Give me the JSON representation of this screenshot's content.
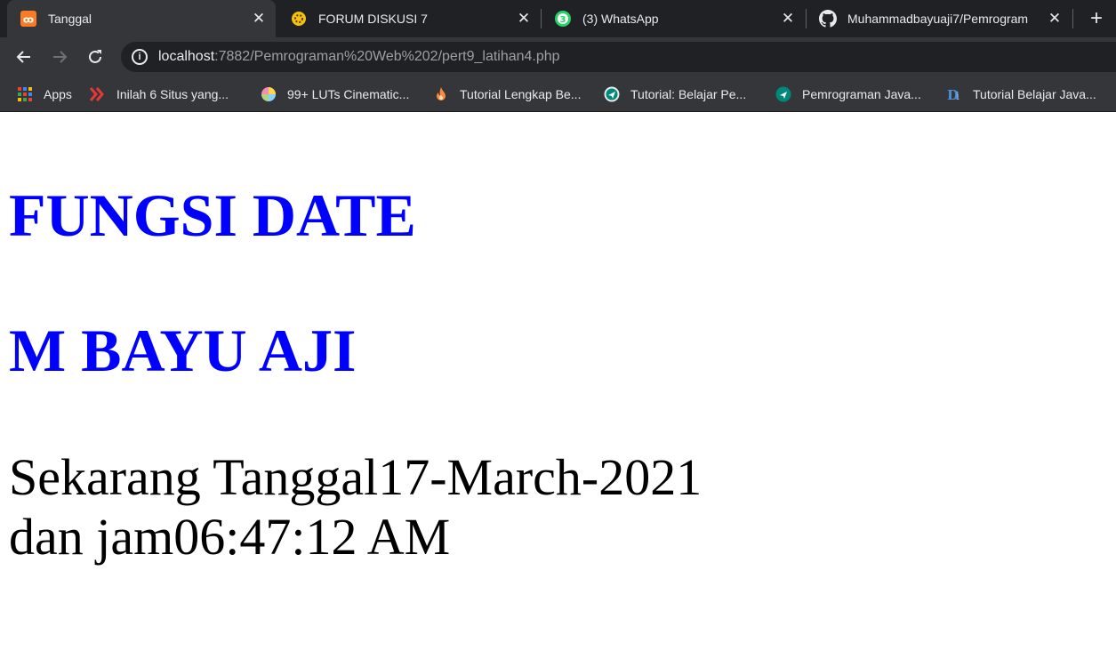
{
  "tabs": [
    {
      "title": "Tanggal",
      "icon": "xampp-icon",
      "active": true
    },
    {
      "title": "FORUM DISKUSI 7",
      "icon": "forum-icon",
      "active": false
    },
    {
      "title": "(3) WhatsApp",
      "icon": "whatsapp-icon",
      "badge": "3",
      "active": false
    },
    {
      "title": "Muhammadbayuaji7/Pemrogram",
      "icon": "github-icon",
      "active": false
    }
  ],
  "address_bar": {
    "host": "localhost",
    "path": ":7882/Pemrograman%20Web%202/pert9_latihan4.php"
  },
  "bookmarks": [
    {
      "label": "Apps",
      "icon": "apps-grid-icon"
    },
    {
      "label": "Inilah 6 Situs yang...",
      "icon": "chevrons-icon"
    },
    {
      "label": "99+ LUTs Cinematic...",
      "icon": "color-wheel-icon"
    },
    {
      "label": "Tutorial Lengkap Be...",
      "icon": "flame-icon"
    },
    {
      "label": "Tutorial: Belajar Pe...",
      "icon": "petanikode-icon"
    },
    {
      "label": "Pemrograman Java...",
      "icon": "petanikode-icon"
    },
    {
      "label": "Tutorial Belajar Java...",
      "icon": "duniailkom-icon"
    }
  ],
  "page": {
    "heading1": "FUNGSI DATE",
    "heading2": "M BAYU AJI",
    "line1": "Sekarang Tanggal17-March-2021",
    "line2": "dan jam06:47:12 AM"
  },
  "colors": {
    "heading": "#0000ff",
    "tabstrip": "#202124",
    "toolbar": "#35363a"
  }
}
